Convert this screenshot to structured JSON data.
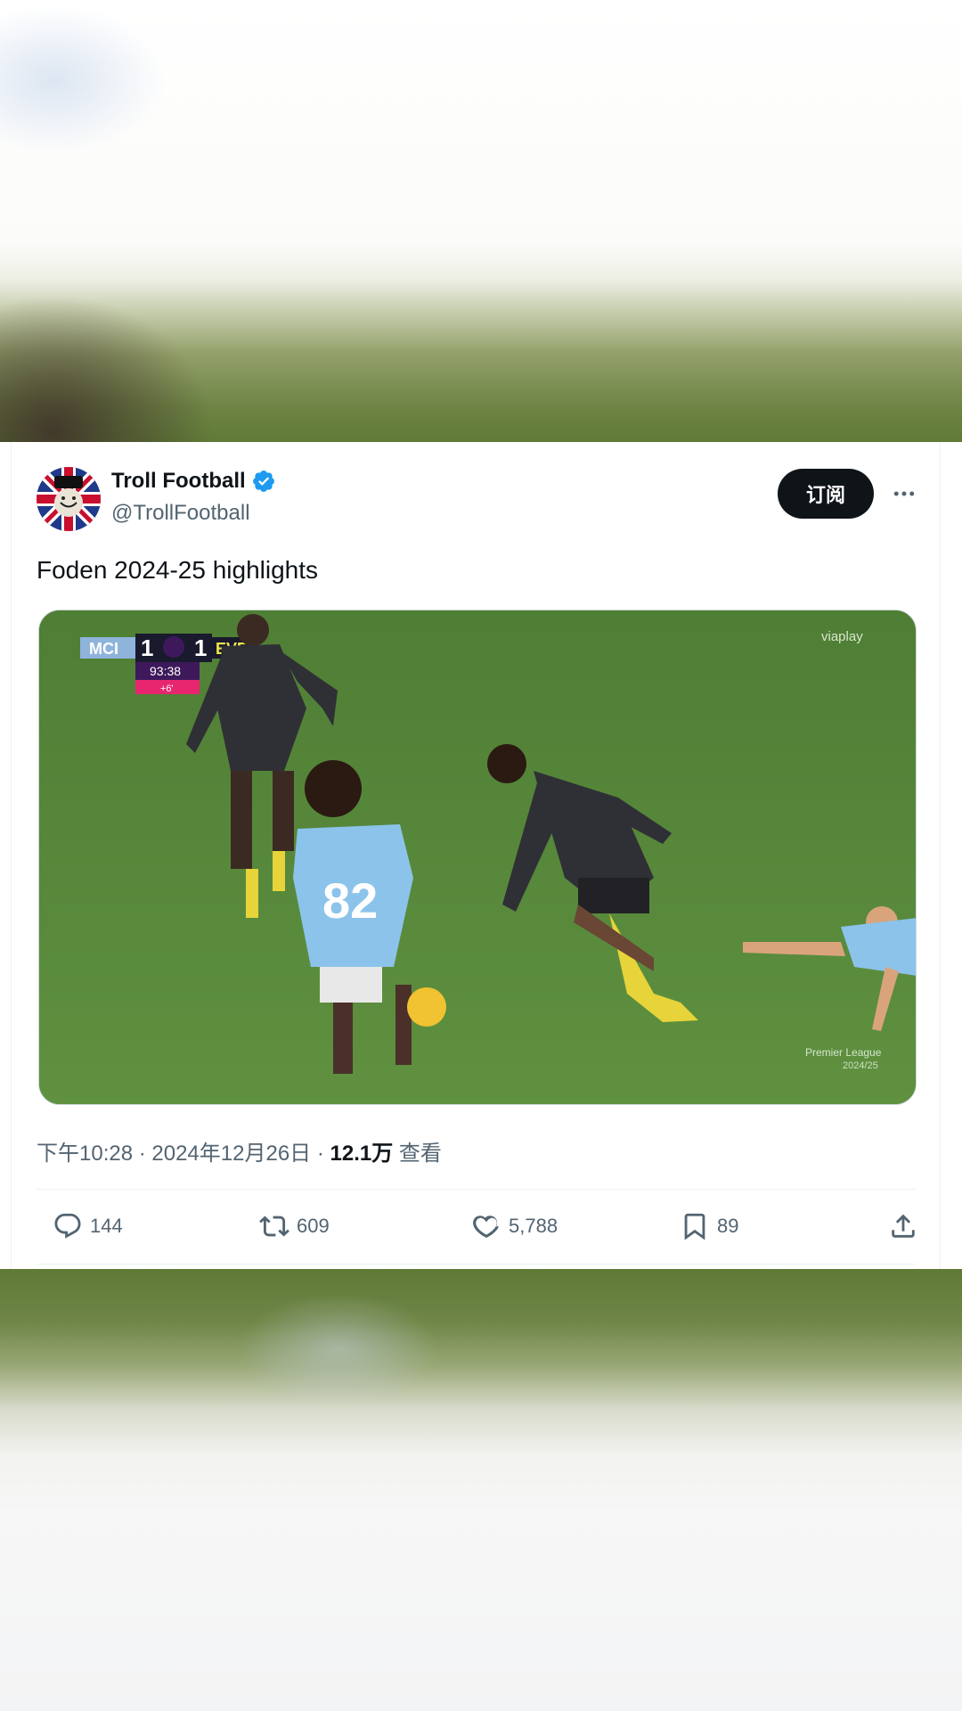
{
  "tweet": {
    "display_name": "Troll Football",
    "handle": "@TrollFootball",
    "subscribe_label": "订阅",
    "text": "Foden 2024-25 highlights",
    "time": "下午10:28 · 2024年12月26日 · ",
    "views_count": "12.1万",
    "views_label": " 查看"
  },
  "scoreboard": {
    "home": "MCI",
    "home_score": "1",
    "away_score": "1",
    "away": "EVE",
    "clock": "93:38",
    "added_time": "+6'",
    "broadcaster": "viaplay",
    "competition": "Premier League",
    "season": "2024/25"
  },
  "actions": {
    "replies": "144",
    "retweets": "609",
    "likes": "5,788",
    "bookmarks": "89"
  },
  "colors": {
    "accent_verified": "#1d9bf0",
    "button_dark": "#0f1419",
    "secondary_text": "#536471",
    "pitch_green": "#5b8a3c"
  },
  "icons": [
    "verified-badge-icon",
    "more-icon",
    "reply-icon",
    "retweet-icon",
    "like-icon",
    "bookmark-icon",
    "share-icon"
  ]
}
